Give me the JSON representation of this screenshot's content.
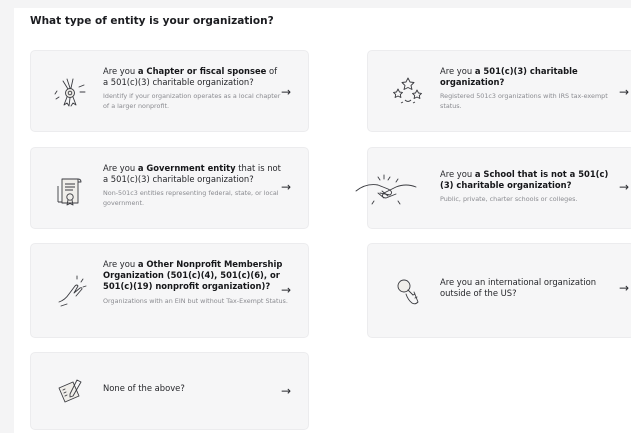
{
  "heading": "What type of entity is your organization?",
  "cards": [
    {
      "pre": "Are you ",
      "bold": "a Chapter or fiscal sponsee",
      "post": " of a 501(c)(3) charitable organization?",
      "desc": "Identify if your organization operates as a local chapter of a larger nonprofit.",
      "icon": "chapter-ribbon-icon"
    },
    {
      "pre": "Are you ",
      "bold": "a 501(c)(3) charitable organization?",
      "post": "",
      "desc": "Registered 501c3 organizations with IRS tax-exempt status.",
      "icon": "stars-icon"
    },
    {
      "pre": "Are you ",
      "bold": "a Government entity",
      "post": " that is not a 501(c)(3) charitable organization?",
      "desc": "Non-501c3 entities representing federal, state, or local government.",
      "icon": "certificate-icon"
    },
    {
      "pre": "Are you ",
      "bold": "a School that is not a 501(c)(3) charitable organization?",
      "post": "",
      "desc": "Public, private, charter schools or colleges.",
      "icon": "handshake-icon"
    },
    {
      "pre": "Are you ",
      "bold": "a Other Nonprofit Membership Organization (501(c)(4), 501(c)(6), or 501(c)(19) nonprofit organization)?",
      "post": "",
      "desc": "Organizations with an EIN but without Tax-Exempt Status.",
      "icon": "hand-icon"
    },
    {
      "pre": "Are you an international organization outside of the US?",
      "bold": "",
      "post": "",
      "desc": "",
      "icon": "magnifier-icon"
    },
    {
      "pre": "None of the above?",
      "bold": "",
      "post": "",
      "desc": "",
      "icon": "notepad-pencil-icon"
    }
  ],
  "arrow": "→",
  "colors": {
    "background": "#f4f4f5",
    "panel": "#ffffff",
    "card": "#f6f6f7",
    "text": "#1f2024",
    "muted": "#8a8b90"
  }
}
